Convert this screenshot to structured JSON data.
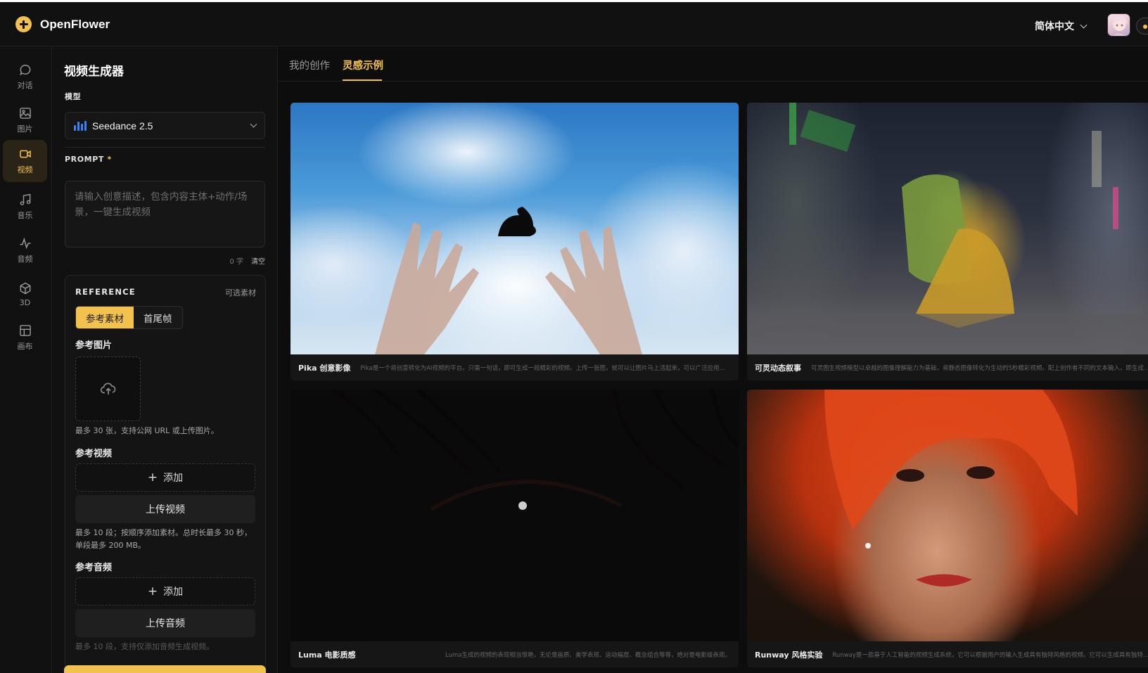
{
  "app": {
    "name": "OpenFlower",
    "language": "简体中文"
  },
  "colors": {
    "accent": "#f2c14e",
    "background": "#0d0d0d",
    "panel": "#111111",
    "model_icon": "#3b82f6"
  },
  "rail": [
    {
      "label": "对话",
      "icon": "chat-bubble-icon"
    },
    {
      "label": "图片",
      "icon": "image-icon"
    },
    {
      "label": "视频",
      "icon": "video-camera-icon",
      "active": true
    },
    {
      "label": "音乐",
      "icon": "music-note-icon"
    },
    {
      "label": "音频",
      "icon": "audio-wave-icon"
    },
    {
      "label": "3D",
      "icon": "cube-icon"
    },
    {
      "label": "画布",
      "icon": "canvas-layout-icon"
    }
  ],
  "panel": {
    "title": "视频生成器",
    "model_label": "模型",
    "model_value": "Seedance 2.5",
    "prompt_label": "PROMPT",
    "prompt_required": "*",
    "prompt_placeholder": "请输入创意描述，包含内容主体+动作/场景，一键生成视频",
    "char_count": "0 字",
    "clear_label": "清空",
    "reference": {
      "title": "REFERENCE",
      "optional": "可选素材",
      "tabs": [
        "参考素材",
        "首尾帧"
      ],
      "active_tab": "参考素材",
      "image_label": "参考图片",
      "image_hint": "最多 30 张，支持公网 URL 或上传图片。",
      "video_label": "参考视频",
      "add_label": "添加",
      "upload_video": "上传视频",
      "video_hint": "最多 10 段；按顺序添加素材。总时长最多 30 秒，单段最多 200 MB。",
      "audio_label": "参考音频",
      "upload_audio": "上传音频",
      "audio_hint": "最多 10 段，支持仅添加音频生成视频。"
    }
  },
  "tabs": {
    "mine": "我的创作",
    "inspiration": "灵感示例",
    "active": "inspiration"
  },
  "gallery": [
    {
      "title": "Pika 创意影像",
      "desc": "Pika是一个将创意转化为AI视频的平台。只需一句话，即可生成一段精彩的视频。上传一张图，就可以让图片马上活起来，可以广泛应用于短视频创作..."
    },
    {
      "title": "可灵动态叙事",
      "desc": "可灵图生视频模型以卓越的图像理解能力为基础，将静态图像转化为生动的5秒精彩视频。配上创作者不同的文本输入，即生成多种多样的运动..."
    },
    {
      "title": "Luma 电影质感",
      "desc": "Luma生成的视频的表现相当惊艳，无论是画质、美学表现、运动幅度、概念组合等等，绝对是电影级表现。"
    },
    {
      "title": "Runway 风格实验",
      "desc": "Runway是一款基于人工智能的视频生成系统，它可以根据用户的输入生成具有独特风格的视频。它可以生成具有独特风格的视频。"
    }
  ]
}
